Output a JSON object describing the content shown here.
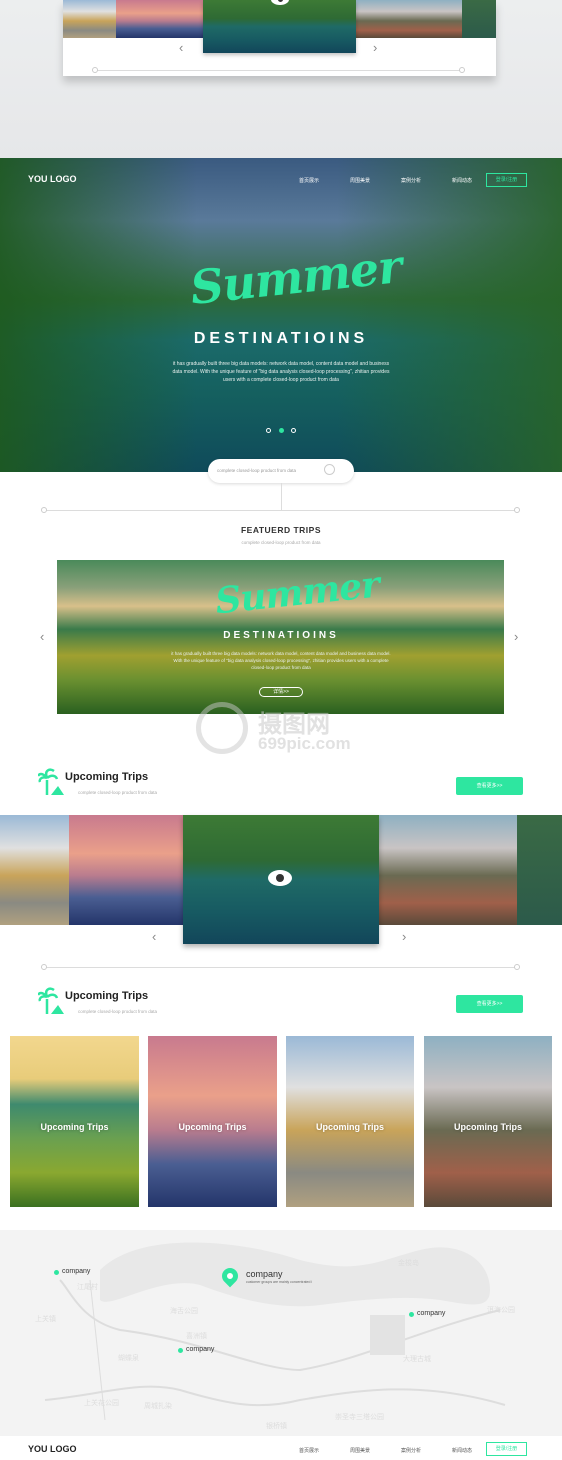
{
  "colors": {
    "accent": "#2ee6a0",
    "map_bg": "#f3f3f3"
  },
  "header": {
    "logo": "YOU LOGO",
    "nav": [
      "首页展示",
      "周围美景",
      "案例分析",
      "新闻动态"
    ],
    "login": "登录/注册"
  },
  "hero": {
    "script_title": "Summer",
    "title": "DESTINATIOINS",
    "description": "it has gradually built three big data models: network data model, content data model and business data model. With the unique feature of \"big data analysis closed-loop processing\", zhitian provides users with a complete closed-loop product from data",
    "slides": 3,
    "active_slide": 2
  },
  "search": {
    "placeholder": "complete closed-loop product from data",
    "icon": "search-icon"
  },
  "featured": {
    "title": "FEATUERD TRIPS",
    "subtitle": "complete closed-loop product from data",
    "banner": {
      "script_title": "Summer",
      "title": "DESTINATIOINS",
      "description": "it has gradually built three big data models: network data model, content data model and business data model. With the unique feature of \"big data analysis closed-loop processing\", zhitian provides users with a complete closed-loop product from data",
      "button": "详情>>"
    }
  },
  "watermark": {
    "cn": "摄图网",
    "url": "699pic.com"
  },
  "upcoming": [
    {
      "title": "Upcoming Trips",
      "subtitle": "complete closed-loop product from data",
      "button": "查看更多>>"
    },
    {
      "title": "Upcoming Trips",
      "subtitle": "complete closed-loop product from data",
      "button": "查看更多>>"
    }
  ],
  "cards": [
    {
      "label": "Upcoming Trips"
    },
    {
      "label": "Upcoming Trips"
    },
    {
      "label": "Upcoming Trips"
    },
    {
      "label": "Upcoming Trips"
    }
  ],
  "map": {
    "main": {
      "title": "company",
      "subtitle": "customer groups are mainly concentrated i"
    },
    "points": [
      "company",
      "company",
      "company"
    ],
    "places": [
      "金梭岛",
      "江尾村",
      "上关镇",
      "海舌公园",
      "喜洲镇",
      "洱海公园",
      "蝴蝶泉",
      "大理古城",
      "上关花公园",
      "周城扎染",
      "崇圣寺三塔公园",
      "银桥镇"
    ]
  },
  "footer": {
    "logo": "YOU LOGO",
    "nav": [
      "首页展示",
      "周围美景",
      "案例分析",
      "新闻动态"
    ],
    "login": "登录/注册"
  }
}
